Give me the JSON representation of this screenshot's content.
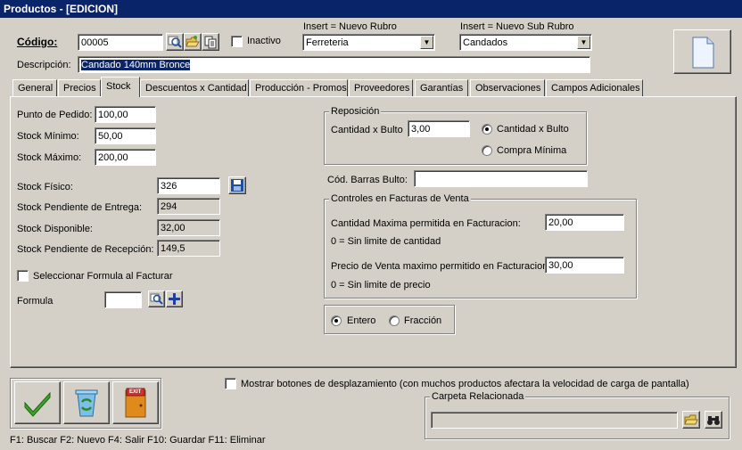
{
  "window": {
    "title": "Productos - [EDICION]"
  },
  "header": {
    "codigo_label": "Código:",
    "codigo_value": "00005",
    "inactivo_label": "Inactivo",
    "rubro_hint": "Insert = Nuevo Rubro",
    "rubro_value": "Ferreteria",
    "subrubro_hint": "Insert = Nuevo Sub Rubro",
    "subrubro_value": "Candados",
    "descripcion_label": "Descripción:",
    "descripcion_value": "Candado 140mm Bronce"
  },
  "tabs": [
    {
      "label": "General"
    },
    {
      "label": "Precios"
    },
    {
      "label": "Stock",
      "active": true
    },
    {
      "label": "Descuentos x Cantidad"
    },
    {
      "label": "Producción - Promos"
    },
    {
      "label": "Proveedores"
    },
    {
      "label": "Garantías"
    },
    {
      "label": "Observaciones"
    },
    {
      "label": "Campos Adicionales"
    }
  ],
  "stock": {
    "punto_pedido_label": "Punto de Pedido:",
    "punto_pedido_value": "100,00",
    "stock_minimo_label": "Stock Mínimo:",
    "stock_minimo_value": "50,00",
    "stock_maximo_label": "Stock Máximo:",
    "stock_maximo_value": "200,00",
    "stock_fisico_label": "Stock Físico:",
    "stock_fisico_value": "326",
    "pend_entrega_label": "Stock Pendiente de Entrega:",
    "pend_entrega_value": "294",
    "disponible_label": "Stock Disponible:",
    "disponible_value": "32,00",
    "pend_recepcion_label": "Stock Pendiente de Recepción:",
    "pend_recepcion_value": "149,5",
    "seleccionar_formula_label": "Seleccionar Formula al Facturar",
    "formula_label": "Formula",
    "formula_value": ""
  },
  "reposicion": {
    "title": "Reposición",
    "cantidad_bulto_label": "Cantidad x Bulto",
    "cantidad_bulto_value": "3,00",
    "radio_cantidad_bulto": "Cantidad x Bulto",
    "radio_compra_minima": "Compra Mínima",
    "selected": "Cantidad x Bulto"
  },
  "barras": {
    "label": "Cód. Barras Bulto:",
    "value": ""
  },
  "controles": {
    "title": "Controles en Facturas de Venta",
    "cantidad_max_label": "Cantidad Maxima permitida en Facturacion:",
    "cantidad_max_value": "20,00",
    "cantidad_hint": "0 = Sin limite de cantidad",
    "precio_max_label": "Precio de Venta maximo permitido en Facturacion:",
    "precio_max_value": "30,00",
    "precio_hint": "0 = Sin limite de precio"
  },
  "tipo": {
    "entero": "Entero",
    "fraccion": "Fracción",
    "selected": "Entero"
  },
  "footer": {
    "desplazamiento_label": "Mostrar botones de desplazamiento  (con muchos productos afectara la velocidad de carga de pantalla)",
    "carpeta_title": "Carpeta Relacionada",
    "carpeta_value": "",
    "exit_text": "EXIT",
    "shortcuts": "F1: Buscar  F2: Nuevo  F4: Salir  F10: Guardar  F11: Eliminar"
  },
  "colors": {
    "titlebar": "#0a246a",
    "face": "#d4d0c8",
    "accept_green": "#3fa02a",
    "exit_orange": "#e08a1e"
  }
}
